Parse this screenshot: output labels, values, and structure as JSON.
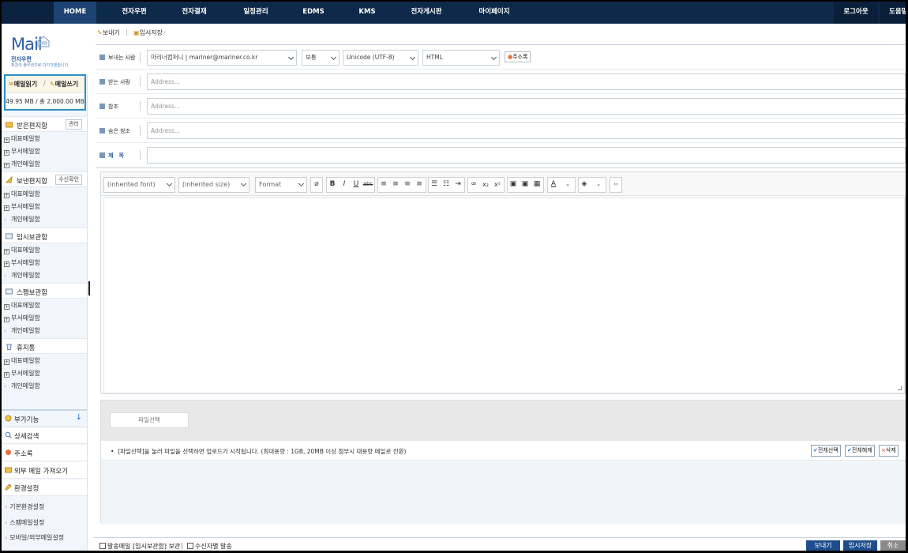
{
  "topnav": {
    "items": [
      "HOME",
      "전자우편",
      "전자결재",
      "일정관리",
      "EDMS",
      "KMS",
      "전자게시판",
      "마이페이지"
    ],
    "active": "HOME",
    "logout": "로그아웃",
    "help": "도움말"
  },
  "sidebar": {
    "logo_mail": "Mail",
    "logo_sub": "전자우편",
    "logo_tagline": "최강의 솔루션으로 다가가겠습니다.",
    "read_label": "메일읽기",
    "separator": "/",
    "write_label": "메일쓰기",
    "quota": "49.95 MB / 총 2,000.00 MB",
    "folders": [
      {
        "label": "받은편지함",
        "btn": "관리",
        "subs": [
          "대표메일함",
          "부서메일함",
          "개인메일함"
        ]
      },
      {
        "label": "보낸편지함",
        "btn": "수신확인",
        "subs": [
          "대표메일함",
          "부서메일함",
          "개인메일함"
        ]
      },
      {
        "label": "임시보관함",
        "btn": "",
        "subs": [
          "대표메일함",
          "부서메일함",
          "개인메일함"
        ]
      },
      {
        "label": "스팸보관함",
        "btn": "",
        "subs": [
          "대표메일함",
          "부서메일함",
          "개인메일함"
        ]
      },
      {
        "label": "휴지통",
        "btn": "",
        "subs": [
          "대표메일함",
          "부서메일함",
          "개인메일함"
        ]
      }
    ],
    "extras_header": "부가기능",
    "extras": [
      "상세검색",
      "주소록",
      "외부 메일 가져오기",
      "환경설정"
    ],
    "settings": [
      "기본환경설정",
      "스팸메일설정",
      "모바일/외부메일설정"
    ]
  },
  "crumb": {
    "send": "보내기",
    "save": "임시저장"
  },
  "form": {
    "from_label": "보내는 사람",
    "from_value": "마리너컴퍼니 | mariner@mariner.co.kr",
    "priority": "보통",
    "encoding": "Unicode (UTF-8)",
    "format": "HTML",
    "addressbook": "주소록",
    "to_label": "받는 사람",
    "cc_label": "참조",
    "bcc_label": "숨은 참조",
    "subject_label": "제　목",
    "address_placeholder": "Address..."
  },
  "editor": {
    "font": "(inherited font)",
    "size": "(inherited size)",
    "format": "Format"
  },
  "attach": {
    "pick": "파일선택",
    "info": "[파일선택]을 눌러 파일을 선택하면 업로드가 시작됩니다. (최대용량 : 1GB, 20MB 이상 첨부시 대용량 메일로 전환)",
    "select_all": "전체선택",
    "deselect_all": "전체해제",
    "delete": "삭제"
  },
  "bottom": {
    "save_sent": "발송메일 [임시보관함] 보관",
    "individual": "수신자별 발송",
    "send": "보내기",
    "draft": "임시저장",
    "cancel": "취소"
  },
  "colors": {
    "nav": "#0e2a4a",
    "accent": "#2a8fc9",
    "send_btn": "#1f4c8c",
    "cancel_btn": "#8a8a8a"
  }
}
